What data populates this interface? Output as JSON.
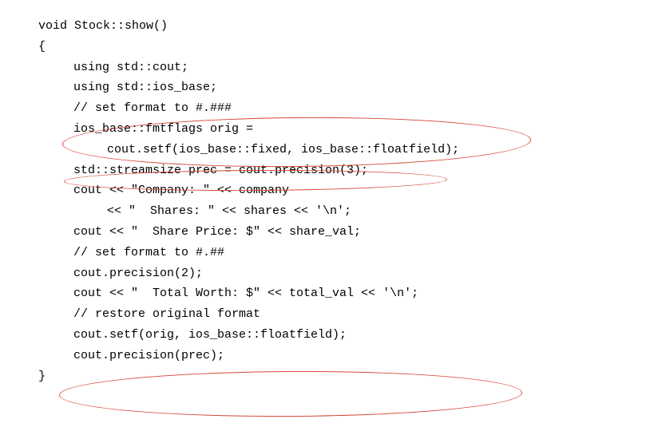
{
  "lines": {
    "l0": "void Stock::show()",
    "l1": "{",
    "l2": "using std::cout;",
    "l3": "using std::ios_base;",
    "l4": "// set format to #.###",
    "l5": "ios_base::fmtflags orig =",
    "l6": "cout.setf(ios_base::fixed, ios_base::floatfield);",
    "l7": "std::streamsize prec = cout.precision(3);",
    "l8": "",
    "l9": "cout << \"Company: \" << company",
    "l10": "<< \"  Shares: \" << shares << '\\n';",
    "l11": "cout << \"  Share Price: $\" << share_val;",
    "l12": "// set format to #.##",
    "l13": "cout.precision(2);",
    "l14": "cout << \"  Total Worth: $\" << total_val << '\\n';",
    "l15": "",
    "l16": "// restore original format",
    "l17": "cout.setf(orig, ios_base::floatfield);",
    "l18": "cout.precision(prec);",
    "l19": "}"
  }
}
